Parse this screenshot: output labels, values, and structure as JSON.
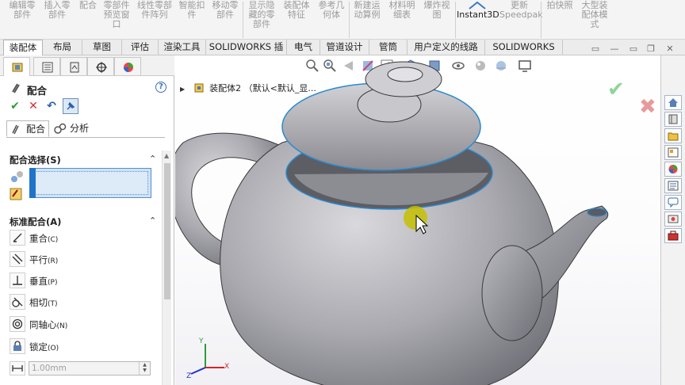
{
  "ribbon": {
    "buttons": [
      {
        "label": "编辑零\n部件",
        "icon": "edit-component-icon"
      },
      {
        "label": "插入零\n部件",
        "icon": "insert-component-icon"
      },
      {
        "label": "配合",
        "icon": "mate-icon"
      },
      {
        "label": "零部件\n预览窗\n口",
        "icon": "component-preview-icon"
      },
      {
        "label": "线性零部\n件阵列",
        "icon": "linear-pattern-icon"
      },
      {
        "label": "智能扣\n件",
        "icon": "smart-fastener-icon"
      },
      {
        "label": "移动零\n部件",
        "icon": "move-component-icon"
      },
      {
        "label": "显示隐\n藏的零\n部件",
        "icon": "show-hidden-icon"
      },
      {
        "label": "装配体\n特征",
        "icon": "assembly-features-icon"
      },
      {
        "label": "参考几\n何体",
        "icon": "reference-geometry-icon"
      },
      {
        "label": "新建运\n动算例",
        "icon": "new-motion-study-icon"
      },
      {
        "label": "材料明\n细表",
        "icon": "bom-icon"
      },
      {
        "label": "爆炸视\n图",
        "icon": "exploded-view-icon"
      },
      {
        "label": "Instant3D",
        "icon": "instant3d-icon"
      },
      {
        "label": "更新\nSpeedpak",
        "icon": "speedpak-icon"
      },
      {
        "label": "拍快照",
        "icon": "snapshot-icon"
      },
      {
        "label": "大型装\n配体模\n式",
        "icon": "large-assembly-icon"
      }
    ]
  },
  "tabs": [
    "装配体",
    "布局",
    "草图",
    "评估",
    "渲染工具",
    "SOLIDWORKS 插件",
    "电气",
    "管道设计",
    "管筒",
    "用户定义的线路",
    "SOLIDWORKS MBD"
  ],
  "property_manager": {
    "title": "配合",
    "help": "?",
    "sub_tabs": [
      "配合",
      "分析"
    ],
    "mate_selections": {
      "title": "配合选择(S)"
    },
    "standard_mates": {
      "title": "标准配合(A)",
      "items": [
        {
          "label": "重合",
          "key": "(C)"
        },
        {
          "label": "平行",
          "key": "(R)"
        },
        {
          "label": "垂直",
          "key": "(P)"
        },
        {
          "label": "相切",
          "key": "(T)"
        },
        {
          "label": "同轴心",
          "key": "(N)"
        },
        {
          "label": "锁定",
          "key": "(O)"
        }
      ],
      "distance": "1.00mm"
    }
  },
  "viewport": {
    "tree_node": "装配体2 （默认<默认_显...",
    "triad": {
      "x": "X",
      "y": "Y",
      "z": "Z"
    }
  },
  "colors": {
    "accent": "#1e74c9",
    "ok": "#8fd59a",
    "cancel": "#e89a9a"
  }
}
